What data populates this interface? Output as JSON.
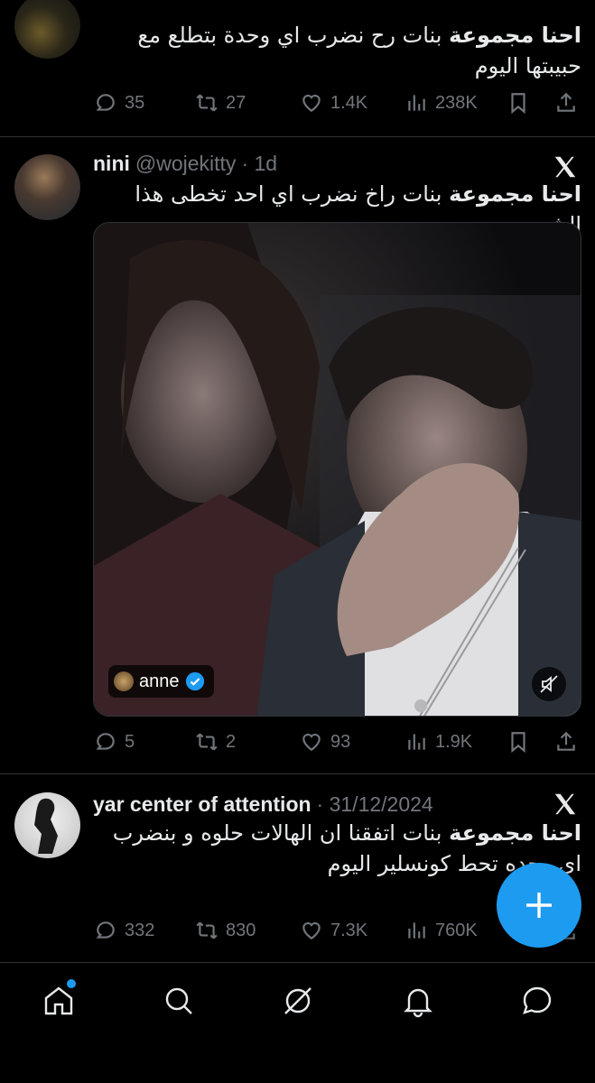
{
  "tweets": [
    {
      "text_bold": "احنا مجموعة",
      "text_rest": " بنات رح نضرب اي وحدة بتطلع مع حبيبتها اليوم",
      "actions": {
        "replies": "35",
        "reposts": "27",
        "likes": "1.4K",
        "views": "238K"
      }
    },
    {
      "name": "nini",
      "handle": "@wojekitty",
      "time": "· 1d",
      "text_bold": "احنا مجموعة",
      "text_rest": " بنات راخ نضرب اي احد تخطى هذا  الشي",
      "media": {
        "tag_name": "anne",
        "verified_color": "#1d9bf0"
      },
      "actions": {
        "replies": "5",
        "reposts": "2",
        "likes": "93",
        "views": "1.9K"
      }
    },
    {
      "name": "yar center of attention",
      "time": "· 31/12/2024",
      "text_bold": "احنا مجموعة",
      "text_rest": " بنات اتفقنا ان الهالات حلوه و بنضرب اي وحده تحط كونسلير اليوم",
      "actions": {
        "replies": "332",
        "reposts": "830",
        "likes": "7.3K",
        "views": "760K"
      }
    }
  ],
  "colors": {
    "accent": "#1d9bf0",
    "muted": "#71767b",
    "background": "#000000"
  },
  "nav": [
    "home-icon",
    "search-icon",
    "grok-icon",
    "notifications-icon",
    "messages-icon"
  ]
}
